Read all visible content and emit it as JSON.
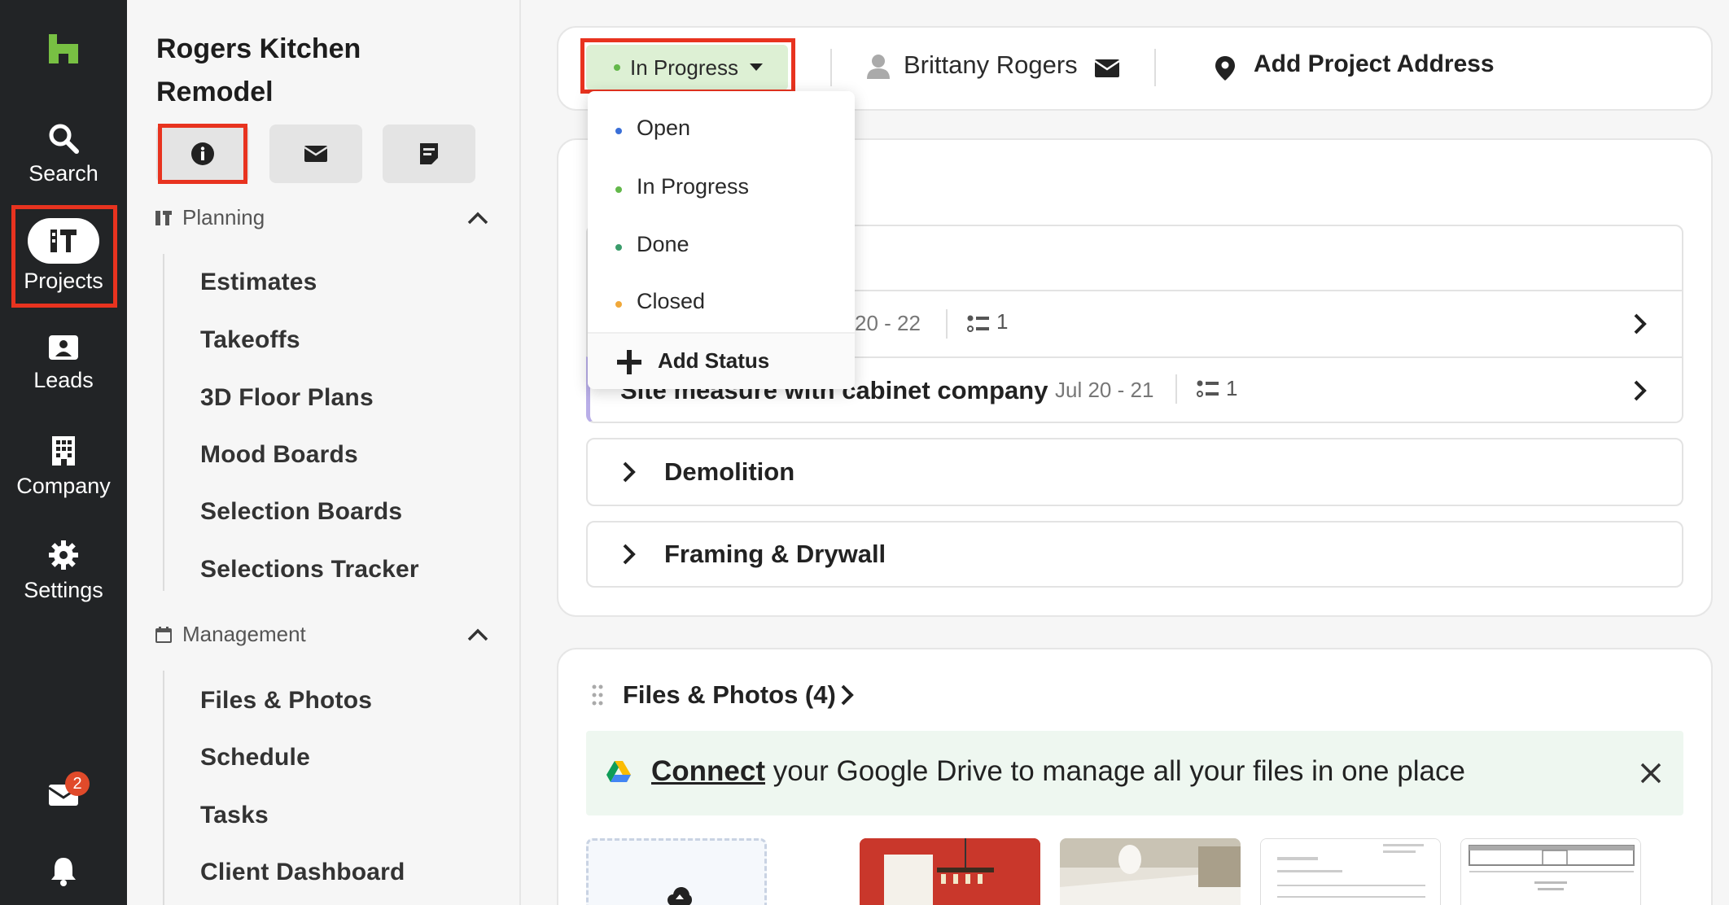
{
  "rail": {
    "items": [
      {
        "label": "Search",
        "icon": "search-icon"
      },
      {
        "label": "Projects",
        "icon": "projects-icon"
      },
      {
        "label": "Leads",
        "icon": "leads-icon"
      },
      {
        "label": "Company",
        "icon": "company-icon"
      },
      {
        "label": "Settings",
        "icon": "settings-icon"
      }
    ],
    "inbox_badge": "2",
    "brand_color": "#78c043"
  },
  "sidebar": {
    "project_title": "Rogers Kitchen Remodel",
    "planning": {
      "heading": "Planning",
      "items": [
        "Estimates",
        "Takeoffs",
        "3D Floor Plans",
        "Mood Boards",
        "Selection Boards",
        "Selections Tracker"
      ]
    },
    "management": {
      "heading": "Management",
      "items": [
        "Files & Photos",
        "Schedule",
        "Tasks",
        "Client Dashboard"
      ]
    }
  },
  "header": {
    "status": "In Progress",
    "client": "Brittany Rogers",
    "address_cta": "Add Project Address"
  },
  "status_dropdown": {
    "options": [
      {
        "label": "Open",
        "color": "#3a6fd8"
      },
      {
        "label": "In Progress",
        "color": "#63b84a"
      },
      {
        "label": "Done",
        "color": "#3a9c6b"
      },
      {
        "label": "Closed",
        "color": "#f0a83a"
      }
    ],
    "add_label": "Add Status"
  },
  "schedule": {
    "rows": [
      {
        "title": "",
        "dates": "20 - 22",
        "count": "1"
      },
      {
        "title": "Site measure with cabinet company",
        "dates": "Jul 20 - 21",
        "count": "1"
      }
    ],
    "groups": [
      "Demolition",
      "Framing & Drywall"
    ]
  },
  "files": {
    "title": "Files & Photos (4)",
    "banner_link": "Connect",
    "banner_text": " your Google Drive to manage all your files in one place"
  }
}
